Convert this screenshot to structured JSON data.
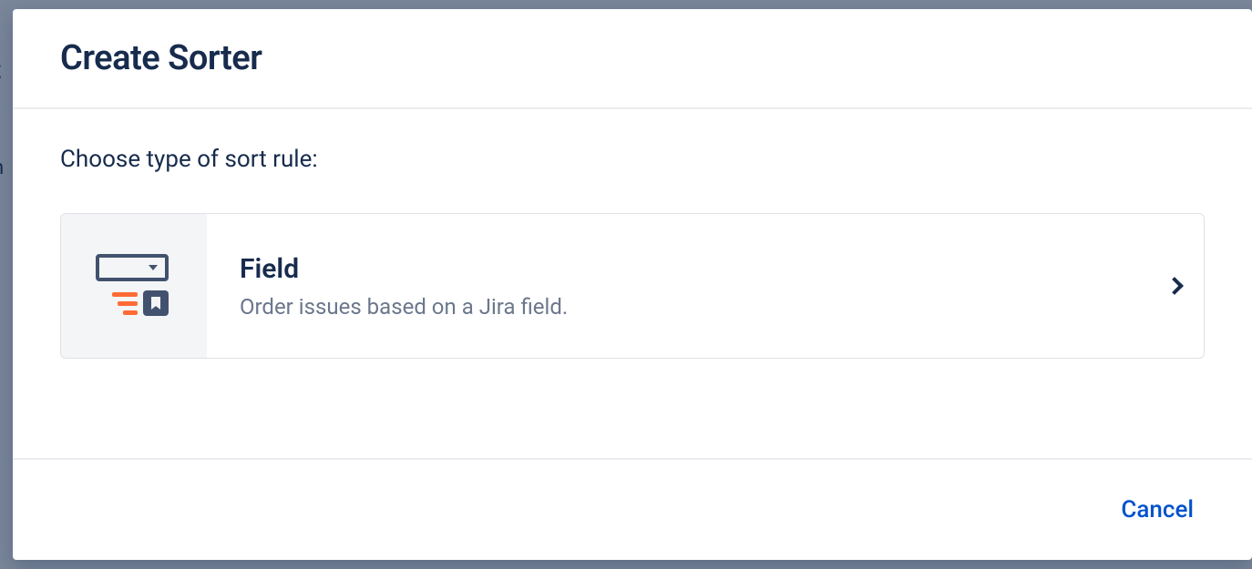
{
  "modal": {
    "title": "Create Sorter",
    "prompt": "Choose type of sort rule:",
    "options": [
      {
        "title": "Field",
        "description": "Order issues based on a Jira field."
      }
    ],
    "footer": {
      "cancel_label": "Cancel"
    }
  }
}
